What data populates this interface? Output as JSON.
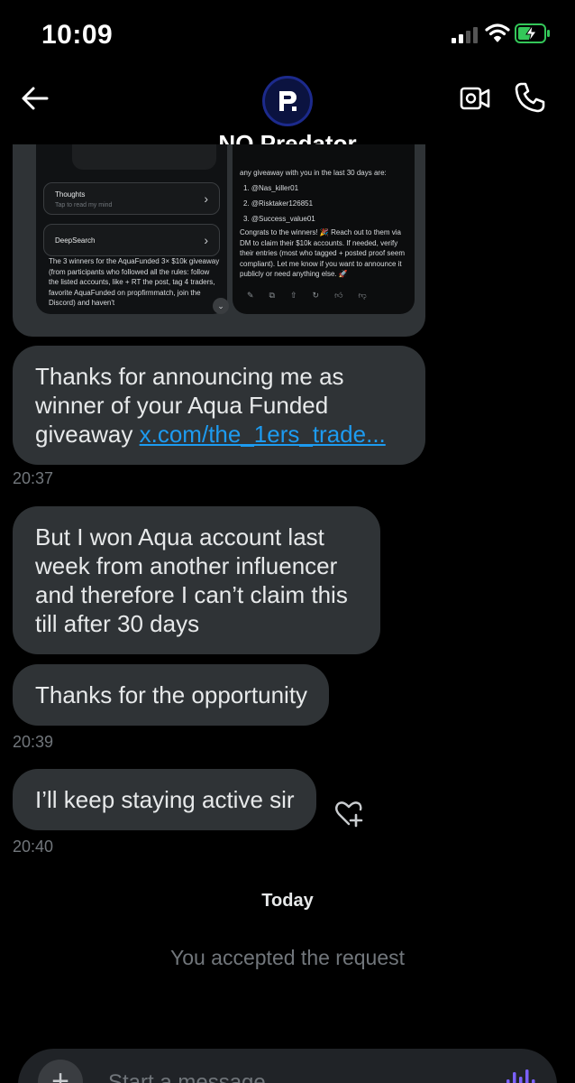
{
  "status_bar": {
    "time": "10:09"
  },
  "header": {
    "title": "NQ Predator"
  },
  "shared_image": {
    "left": {
      "thoughts_title": "Thoughts",
      "thoughts_subtitle": "Tap to read my mind",
      "deepsearch_title": "DeepSearch",
      "paragraph": "The 3 winners for the AquaFunded 3× $10k giveaway (from participants who followed all the rules: follow the listed accounts, like + RT the post, tag 4 traders, favorite AquaFunded on propfirmmatch, join the Discord) and haven't"
    },
    "right": {
      "intro": "any giveaway with you in the last 30 days are:",
      "winners": [
        "1.  @Nas_killer01",
        "2.  @Risktaker126851",
        "3.  @Success_value01"
      ],
      "paragraph": "Congrats to the winners! 🎉 Reach out to them via DM to claim their $10k accounts. If needed, verify their entries (most who tagged + posted proof seem compliant). Let me know if you want to announce it publicly or need anything else. 🚀"
    }
  },
  "messages": [
    {
      "text_line1": "Thanks for announcing me as",
      "text_line2": "winner of your Aqua Funded",
      "text_line3_prefix": "giveaway ",
      "link": "x.com/the_1ers_trade...",
      "time": "20:37"
    },
    {
      "text": "But I won Aqua account last week from another influencer and therefore I can’t claim this till after 30 days"
    },
    {
      "text": "Thanks for the opportunity",
      "time": "20:39"
    },
    {
      "text": "I’ll keep staying active sir",
      "time": "20:40"
    }
  ],
  "divider": {
    "label": "Today"
  },
  "system_message": "You accepted the request",
  "composer": {
    "placeholder": "Start a message"
  },
  "colors": {
    "bubble": "#2f3336",
    "link": "#1d9bf0",
    "muted": "#71767b",
    "battery": "#34c759",
    "voice": "#7b61ff"
  },
  "icons": {
    "back": "arrow-left-icon",
    "video": "video-camera-icon",
    "call": "phone-icon",
    "react": "heart-plus-icon",
    "add": "plus-icon",
    "voice": "waveform-icon",
    "wifi": "wifi-icon",
    "battery": "battery-charging-icon",
    "signal": "signal-icon"
  }
}
